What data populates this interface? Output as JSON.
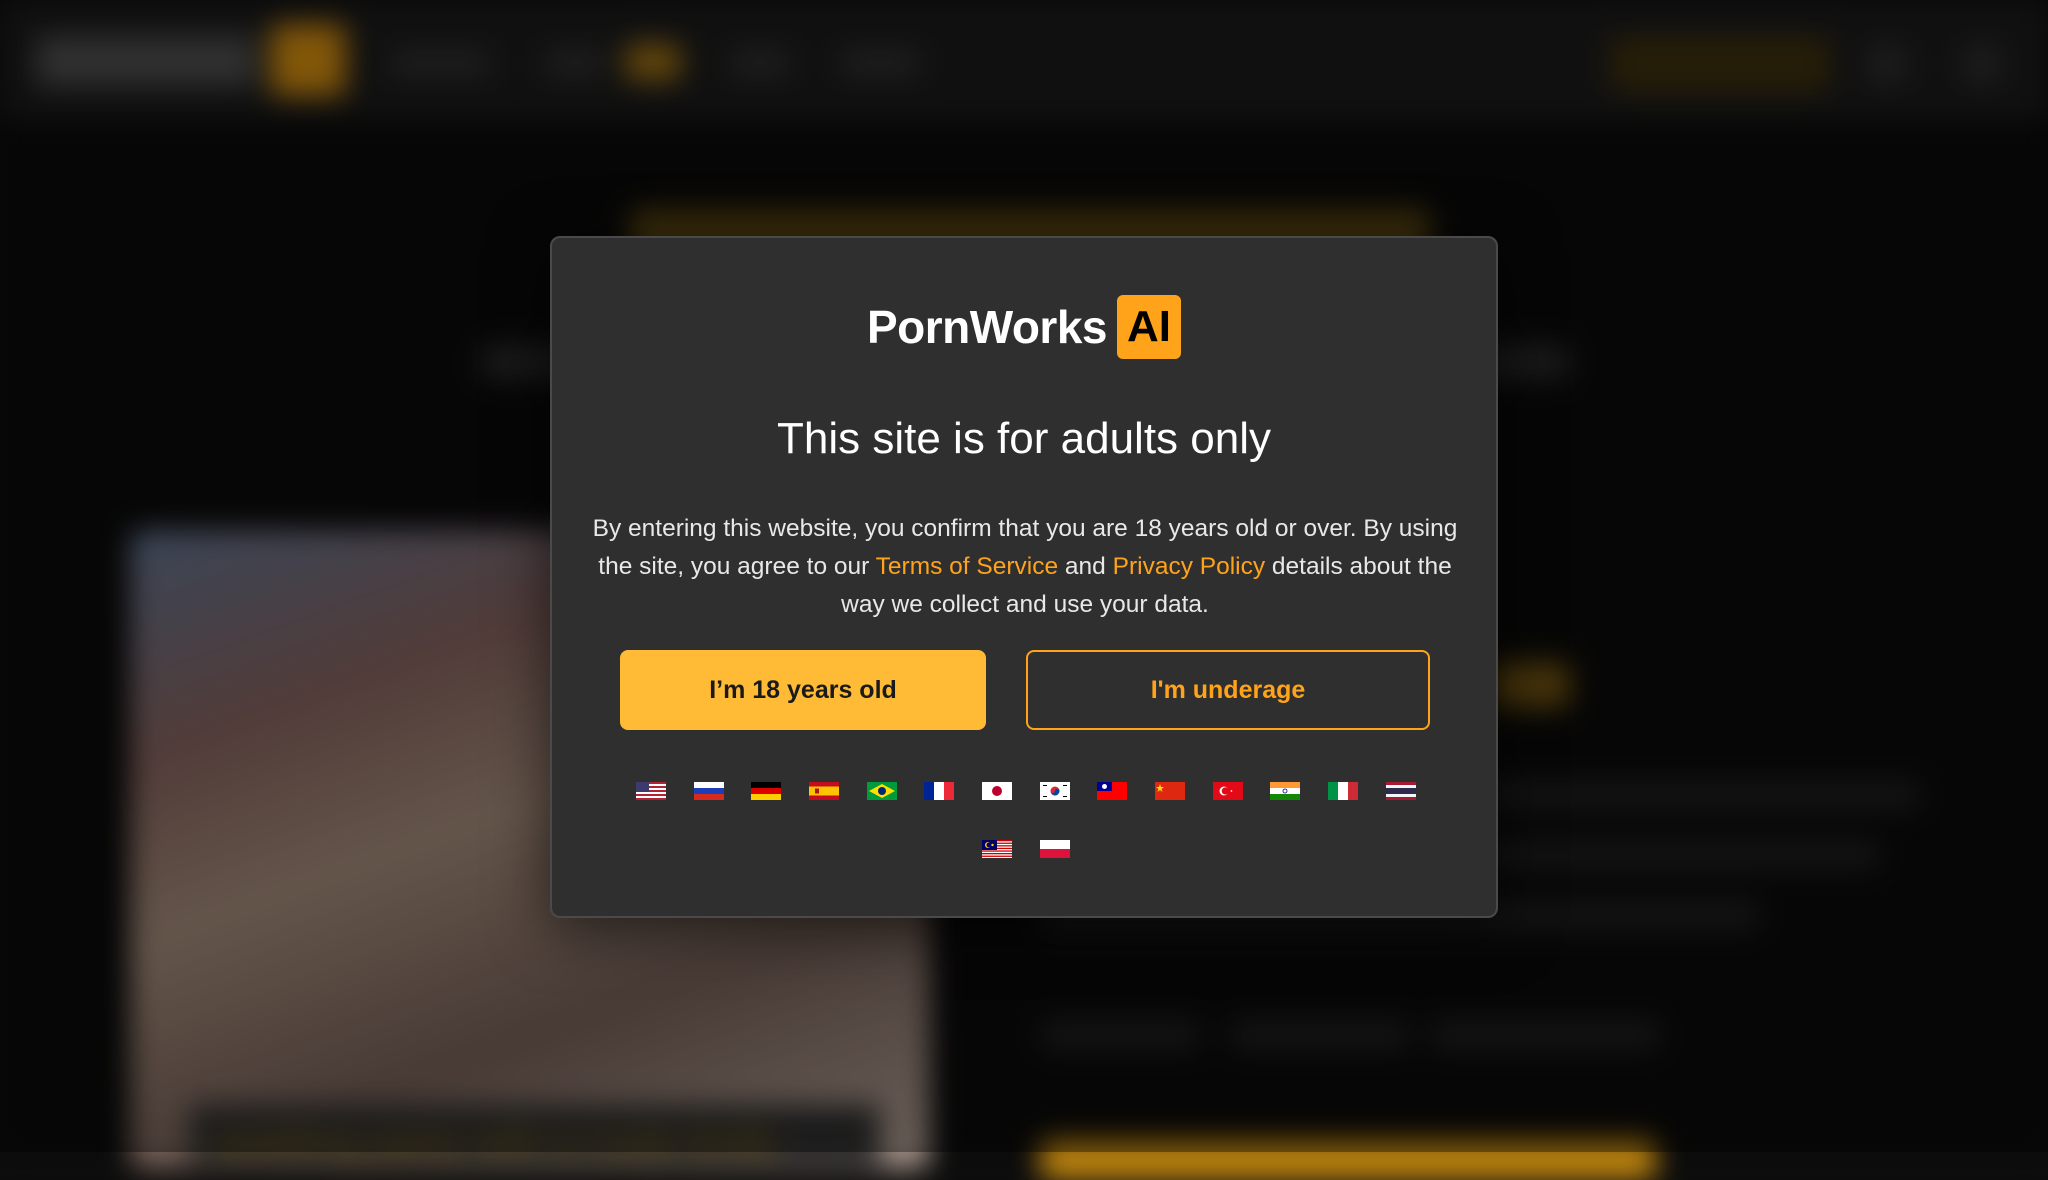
{
  "brand": {
    "name": "PornWorks",
    "badge": "AI"
  },
  "background": {
    "caption": "wedding party with a nude bride"
  },
  "modal": {
    "title": "This site is for adults only",
    "body_part1": "By entering this website, you confirm that you are 18 years old or over. By using the site, you agree to our",
    "terms_link": "Terms of Service",
    "body_and": "and",
    "privacy_link": "Privacy Policy",
    "body_part2": "details about the way we collect and use your data.",
    "adult_button": "I’m 18 years old",
    "underage_button": "I'm underage"
  },
  "colors": {
    "accent": "#ffa31a",
    "adult_button": "#ffbb35",
    "modal_bg": "#2f2f2f"
  },
  "languages": [
    {
      "flag": "us-flag-icon"
    },
    {
      "flag": "ru-flag-icon"
    },
    {
      "flag": "de-flag-icon"
    },
    {
      "flag": "es-flag-icon"
    },
    {
      "flag": "br-flag-icon"
    },
    {
      "flag": "fr-flag-icon"
    },
    {
      "flag": "jp-flag-icon"
    },
    {
      "flag": "kr-flag-icon"
    },
    {
      "flag": "tw-flag-icon"
    },
    {
      "flag": "cn-flag-icon"
    },
    {
      "flag": "tr-flag-icon"
    },
    {
      "flag": "in-flag-icon"
    },
    {
      "flag": "it-flag-icon"
    },
    {
      "flag": "th-flag-icon"
    },
    {
      "flag": "my-flag-icon"
    },
    {
      "flag": "pl-flag-icon"
    }
  ]
}
